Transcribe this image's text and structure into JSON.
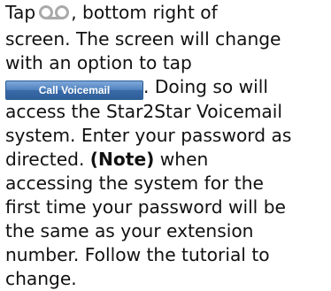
{
  "instructions": {
    "line1_a": "Tap",
    "line1_b": ", bottom right of",
    "line2": "screen. The screen will change",
    "line3": "with an option to tap",
    "line4_b": ". Doing so will",
    "line5": "access the Star2Star Voicemail",
    "line6": "system. Enter your password as",
    "line7_a": "directed.",
    "line7_note": "(Note)",
    "line7_b": "when",
    "line8": "accessing the system for the",
    "line9": "first time your password will be",
    "line10": "the same as your extension",
    "line11": "number. Follow the tutorial to",
    "line12": "change."
  },
  "voicemail_icon": "voicemail-icon",
  "call_voicemail_button": "Call Voicemail",
  "colors": {
    "text": "#111111",
    "icon": "#aaaaaa",
    "button_top": "#7fa9da",
    "button_bottom": "#2f5e98"
  }
}
